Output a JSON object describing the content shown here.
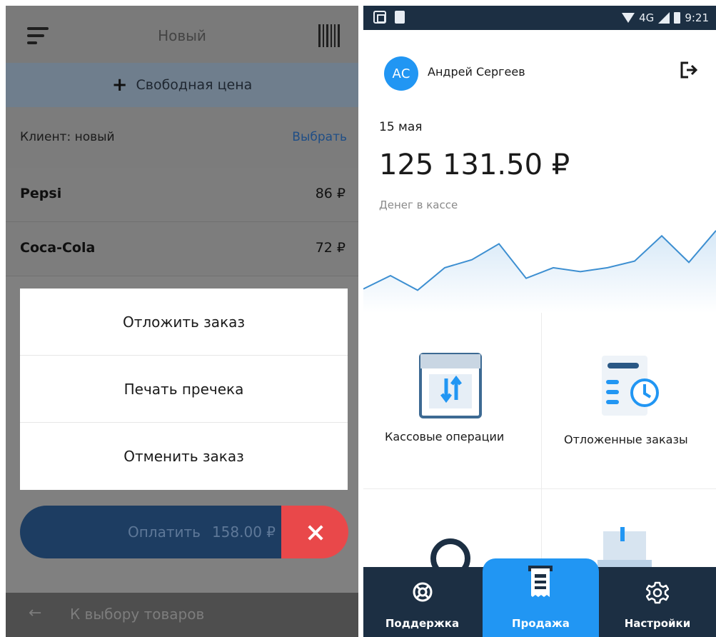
{
  "left_screen": {
    "header": {
      "title": "Новый"
    },
    "free_price_label": "Свободная цена",
    "client": {
      "label": "Клиент: новый",
      "choose_link": "Выбрать"
    },
    "cart_items": [
      {
        "name": "Pepsi",
        "price": "86 ₽"
      },
      {
        "name": "Coca-Cola",
        "price": "72 ₽"
      }
    ],
    "action_menu": {
      "options": [
        "Отложить заказ",
        "Печать пречека",
        "Отменить заказ"
      ]
    },
    "pay_button": {
      "label": "Оплатить",
      "amount": "158.00 ₽"
    },
    "back_link": "К выбору товаров"
  },
  "right_screen": {
    "status_bar": {
      "network": "4G",
      "time": "9:21"
    },
    "user": {
      "initials": "АС",
      "name": "Андрей Сергеев"
    },
    "summary": {
      "date": "15 мая",
      "amount": "125 131.50 ₽",
      "amount_label": "Денег в кассе"
    },
    "chart_data": {
      "type": "area",
      "values": [
        18,
        28,
        17,
        34,
        40,
        52,
        26,
        34,
        31,
        34,
        39,
        58,
        38,
        62
      ],
      "ylim": [
        0,
        70
      ]
    },
    "tiles": [
      {
        "label": "Кассовые операции"
      },
      {
        "label": "Отложенные заказы"
      }
    ],
    "bottom_nav": [
      {
        "label": "Поддержка"
      },
      {
        "label": "Продажа"
      },
      {
        "label": "Настройки"
      }
    ],
    "colors": {
      "accent": "#2196f3",
      "navbar": "#1c2f43",
      "pay_button": "#1d3d62",
      "cancel_button": "#e9484a",
      "tile_icon": "#3d6a93",
      "chart_line": "#3d8fd1"
    }
  }
}
